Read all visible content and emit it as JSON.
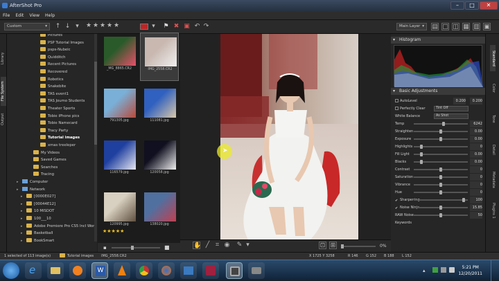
{
  "window": {
    "title": "AfterShot Pro"
  },
  "menu": [
    "File",
    "Edit",
    "View",
    "Help"
  ],
  "toolbar": {
    "preset": "Custom",
    "layer": "Main Layer"
  },
  "left_tabs": [
    "Library",
    "File System",
    "Output"
  ],
  "tree": [
    {
      "label": "Pictures",
      "type": "folder"
    },
    {
      "label": "PSP Tutorial Images",
      "type": "folder"
    },
    {
      "label": "psps-Nubeic",
      "type": "folder"
    },
    {
      "label": "Quidditch",
      "type": "folder"
    },
    {
      "label": "Recent Pictures",
      "type": "folder"
    },
    {
      "label": "Recovered",
      "type": "folder"
    },
    {
      "label": "Robotics",
      "type": "folder"
    },
    {
      "label": "Snakebite",
      "type": "folder"
    },
    {
      "label": "TAS event1",
      "type": "folder"
    },
    {
      "label": "TAS Joumo Students",
      "type": "folder"
    },
    {
      "label": "Theater Sports",
      "type": "folder"
    },
    {
      "label": "Tobie iPhone pics",
      "type": "folder"
    },
    {
      "label": "Tobie Namecard",
      "type": "folder"
    },
    {
      "label": "Tracy Party",
      "type": "folder"
    },
    {
      "label": "Tutorial images",
      "type": "folder",
      "selected": true
    },
    {
      "label": "xmas treeleper",
      "type": "folder"
    },
    {
      "label": "My Videos",
      "type": "folder"
    },
    {
      "label": "Saved Games",
      "type": "folder"
    },
    {
      "label": "Searches",
      "type": "folder"
    },
    {
      "label": "Tracing",
      "type": "folder"
    },
    {
      "label": "Computer",
      "type": "computer"
    },
    {
      "label": "Network",
      "type": "computer"
    },
    {
      "label": "[0000E027]",
      "type": "folder"
    },
    {
      "label": "[00044E12]",
      "type": "folder"
    },
    {
      "label": "10 MISDOT",
      "type": "folder"
    },
    {
      "label": "100___10",
      "type": "folder"
    },
    {
      "label": "Adobe Premiere Pro CS5 Incl Work",
      "type": "folder"
    },
    {
      "label": "Basketball",
      "type": "folder"
    },
    {
      "label": "BookSmart",
      "type": "folder"
    }
  ],
  "thumbnails": [
    {
      "name": "_MG_8865.CR2",
      "colors": [
        "#2a5a2a",
        "#e8506a"
      ]
    },
    {
      "name": "IMG_2558.CR2",
      "colors": [
        "#c8b8b0",
        "#f0f0f0"
      ],
      "selected": true
    },
    {
      "name": "791305.jpg",
      "colors": [
        "#7ab0d8",
        "#b84a3a"
      ]
    },
    {
      "name": "111081.jpg",
      "colors": [
        "#3060c0",
        "#d8c8a8"
      ]
    },
    {
      "name": "116579.jpg",
      "colors": [
        "#2040a0",
        "#e8e8f0"
      ]
    },
    {
      "name": "120058.jpg",
      "colors": [
        "#101020",
        "#f0f0f0"
      ]
    },
    {
      "name": "120995.jpg",
      "colors": [
        "#d8d0c0",
        "#605040"
      ],
      "stars": "★★★★★"
    },
    {
      "name": "138020.jpg",
      "colors": [
        "#5070a0",
        "#c04050"
      ]
    }
  ],
  "histogram_title": "Histogram",
  "basic_title": "Basic Adjustments",
  "adjustments": [
    {
      "label": "AutoLevel",
      "kind": "check2",
      "v1": "0.200",
      "v2": "0.200"
    },
    {
      "label": "Perfectly Clear",
      "kind": "checkdd",
      "dd": "Tint Off"
    },
    {
      "label": "White Balance",
      "kind": "dd",
      "dd": "As Shot"
    },
    {
      "label": "Temp",
      "kind": "slider",
      "value": "6242",
      "pos": 0.55
    },
    {
      "label": "Straighten",
      "kind": "slider",
      "value": "0.00",
      "pos": 0.5
    },
    {
      "label": "Exposure",
      "kind": "slider",
      "value": "0.00",
      "pos": 0.5
    },
    {
      "label": "Highlights",
      "kind": "slider",
      "value": "0",
      "pos": 0.12
    },
    {
      "label": "Fill Light",
      "kind": "slider",
      "value": "0.00",
      "pos": 0.12
    },
    {
      "label": "Blacks",
      "kind": "slider",
      "value": "0.00",
      "pos": 0.12
    },
    {
      "label": "Contrast",
      "kind": "slider",
      "value": "0",
      "pos": 0.5
    },
    {
      "label": "Saturation",
      "kind": "slider",
      "value": "0",
      "pos": 0.5
    },
    {
      "label": "Vibrance",
      "kind": "slider",
      "value": "0",
      "pos": 0.5
    },
    {
      "label": "Hue",
      "kind": "slider",
      "value": "0",
      "pos": 0.5
    },
    {
      "label": "Sharpening",
      "kind": "slider",
      "value": "100",
      "pos": 0.95,
      "checked": true
    },
    {
      "label": "Noise Ninja",
      "kind": "slider",
      "value": "15.85",
      "pos": 0.5,
      "checked": true
    },
    {
      "label": "RAW Noise",
      "kind": "slider",
      "value": "50",
      "pos": 0.5
    },
    {
      "label": "Keywords",
      "kind": "label"
    }
  ],
  "right_tabs": [
    "Standard",
    "Color",
    "Tone",
    "Detail",
    "Metadata",
    "Plugins 1"
  ],
  "center_toolbar": {
    "zoom": "0%"
  },
  "status": {
    "left": "1 selected of 113 image(s)",
    "folder": "Tutorial images",
    "file": "IMG_2558.CR2",
    "coords": "X 1725 Y 3258",
    "r": "R 146",
    "g": "G 152",
    "b": "B 188",
    "l": "L 152"
  },
  "clock": {
    "time": "5:21 PM",
    "date": "12/20/2011"
  }
}
